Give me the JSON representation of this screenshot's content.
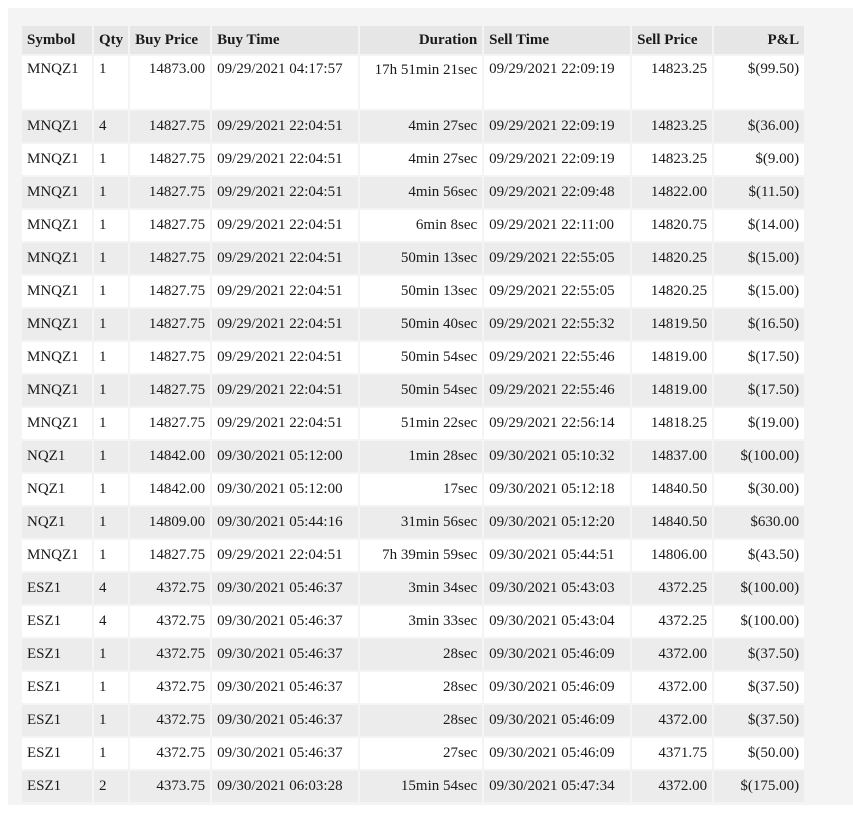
{
  "table": {
    "columns": [
      "Symbol",
      "Qty",
      "Buy Price",
      "Buy Time",
      "Duration",
      "Sell Time",
      "Sell Price",
      "P&L"
    ],
    "rows": [
      [
        "MNQZ1",
        "1",
        "14873.00",
        "09/29/2021 04:17:57",
        "17h 51min 21sec",
        "09/29/2021 22:09:19",
        "14823.25",
        "$(99.50)"
      ],
      [
        "MNQZ1",
        "4",
        "14827.75",
        "09/29/2021 22:04:51",
        "4min 27sec",
        "09/29/2021 22:09:19",
        "14823.25",
        "$(36.00)"
      ],
      [
        "MNQZ1",
        "1",
        "14827.75",
        "09/29/2021 22:04:51",
        "4min 27sec",
        "09/29/2021 22:09:19",
        "14823.25",
        "$(9.00)"
      ],
      [
        "MNQZ1",
        "1",
        "14827.75",
        "09/29/2021 22:04:51",
        "4min 56sec",
        "09/29/2021 22:09:48",
        "14822.00",
        "$(11.50)"
      ],
      [
        "MNQZ1",
        "1",
        "14827.75",
        "09/29/2021 22:04:51",
        "6min 8sec",
        "09/29/2021 22:11:00",
        "14820.75",
        "$(14.00)"
      ],
      [
        "MNQZ1",
        "1",
        "14827.75",
        "09/29/2021 22:04:51",
        "50min 13sec",
        "09/29/2021 22:55:05",
        "14820.25",
        "$(15.00)"
      ],
      [
        "MNQZ1",
        "1",
        "14827.75",
        "09/29/2021 22:04:51",
        "50min 13sec",
        "09/29/2021 22:55:05",
        "14820.25",
        "$(15.00)"
      ],
      [
        "MNQZ1",
        "1",
        "14827.75",
        "09/29/2021 22:04:51",
        "50min 40sec",
        "09/29/2021 22:55:32",
        "14819.50",
        "$(16.50)"
      ],
      [
        "MNQZ1",
        "1",
        "14827.75",
        "09/29/2021 22:04:51",
        "50min 54sec",
        "09/29/2021 22:55:46",
        "14819.00",
        "$(17.50)"
      ],
      [
        "MNQZ1",
        "1",
        "14827.75",
        "09/29/2021 22:04:51",
        "50min 54sec",
        "09/29/2021 22:55:46",
        "14819.00",
        "$(17.50)"
      ],
      [
        "MNQZ1",
        "1",
        "14827.75",
        "09/29/2021 22:04:51",
        "51min 22sec",
        "09/29/2021 22:56:14",
        "14818.25",
        "$(19.00)"
      ],
      [
        "NQZ1",
        "1",
        "14842.00",
        "09/30/2021 05:12:00",
        "1min 28sec",
        "09/30/2021 05:10:32",
        "14837.00",
        "$(100.00)"
      ],
      [
        "NQZ1",
        "1",
        "14842.00",
        "09/30/2021 05:12:00",
        "17sec",
        "09/30/2021 05:12:18",
        "14840.50",
        "$(30.00)"
      ],
      [
        "NQZ1",
        "1",
        "14809.00",
        "09/30/2021 05:44:16",
        "31min 56sec",
        "09/30/2021 05:12:20",
        "14840.50",
        "$630.00"
      ],
      [
        "MNQZ1",
        "1",
        "14827.75",
        "09/29/2021 22:04:51",
        "7h 39min 59sec",
        "09/30/2021 05:44:51",
        "14806.00",
        "$(43.50)"
      ],
      [
        "ESZ1",
        "4",
        "4372.75",
        "09/30/2021 05:46:37",
        "3min 34sec",
        "09/30/2021 05:43:03",
        "4372.25",
        "$(100.00)"
      ],
      [
        "ESZ1",
        "4",
        "4372.75",
        "09/30/2021 05:46:37",
        "3min 33sec",
        "09/30/2021 05:43:04",
        "4372.25",
        "$(100.00)"
      ],
      [
        "ESZ1",
        "1",
        "4372.75",
        "09/30/2021 05:46:37",
        "28sec",
        "09/30/2021 05:46:09",
        "4372.00",
        "$(37.50)"
      ],
      [
        "ESZ1",
        "1",
        "4372.75",
        "09/30/2021 05:46:37",
        "28sec",
        "09/30/2021 05:46:09",
        "4372.00",
        "$(37.50)"
      ],
      [
        "ESZ1",
        "1",
        "4372.75",
        "09/30/2021 05:46:37",
        "28sec",
        "09/30/2021 05:46:09",
        "4372.00",
        "$(37.50)"
      ],
      [
        "ESZ1",
        "1",
        "4372.75",
        "09/30/2021 05:46:37",
        "27sec",
        "09/30/2021 05:46:09",
        "4371.75",
        "$(50.00)"
      ],
      [
        "ESZ1",
        "2",
        "4373.75",
        "09/30/2021 06:03:28",
        "15min 54sec",
        "09/30/2021 05:47:34",
        "4372.00",
        "$(175.00)"
      ]
    ]
  }
}
